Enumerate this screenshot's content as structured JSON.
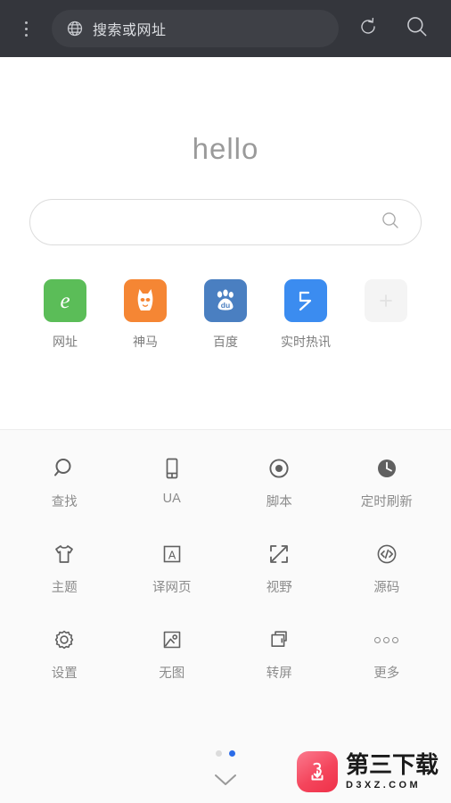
{
  "topbar": {
    "menu_icon": "overflow-menu-icon",
    "globe_icon": "globe-icon",
    "address_placeholder": "搜索或网址",
    "refresh_icon": "refresh-icon",
    "search_icon": "search-icon",
    "background_color": "#34363c",
    "field_color": "#3e4046"
  },
  "hero": {
    "greeting": "hello",
    "search_icon": "search-icon",
    "search_value": "",
    "search_placeholder": ""
  },
  "shortcuts": [
    {
      "label": "网址",
      "icon": "uc-letter-e-icon",
      "color": "#5bbd58"
    },
    {
      "label": "神马",
      "icon": "shenma-horse-icon",
      "color": "#f58634"
    },
    {
      "label": "百度",
      "icon": "baidu-paw-icon",
      "color": "#4a7fc1"
    },
    {
      "label": "实时热讯",
      "icon": "arrow-flash-icon",
      "color": "#3b8cf0"
    },
    {
      "label": "",
      "icon": "plus-icon",
      "color": "#f4f4f4"
    }
  ],
  "tools": {
    "rows": [
      [
        {
          "label": "查找",
          "icon": "magnifier-icon"
        },
        {
          "label": "UA",
          "icon": "phone-outline-icon"
        },
        {
          "label": "脚本",
          "icon": "script-dot-icon"
        },
        {
          "label": "定时刷新",
          "icon": "clock-icon"
        }
      ],
      [
        {
          "label": "主题",
          "icon": "tshirt-icon"
        },
        {
          "label": "译网页",
          "icon": "translate-a-icon"
        },
        {
          "label": "视野",
          "icon": "expand-arrows-icon"
        },
        {
          "label": "源码",
          "icon": "source-code-icon"
        }
      ],
      [
        {
          "label": "设置",
          "icon": "gear-icon"
        },
        {
          "label": "无图",
          "icon": "no-image-icon"
        },
        {
          "label": "转屏",
          "icon": "rotate-screen-icon"
        },
        {
          "label": "更多",
          "icon": "three-circles-icon"
        }
      ]
    ]
  },
  "pager": {
    "total": 2,
    "active_index": 1,
    "active_color": "#2b6ce8",
    "inactive_color": "#dcdcdc"
  },
  "collapse": {
    "icon": "chevron-down-icon"
  },
  "watermark": {
    "logo_icon": "download-3-logo-icon",
    "title": "第三下载",
    "domain": "D3XZ.COM",
    "color": "#f4455c"
  }
}
